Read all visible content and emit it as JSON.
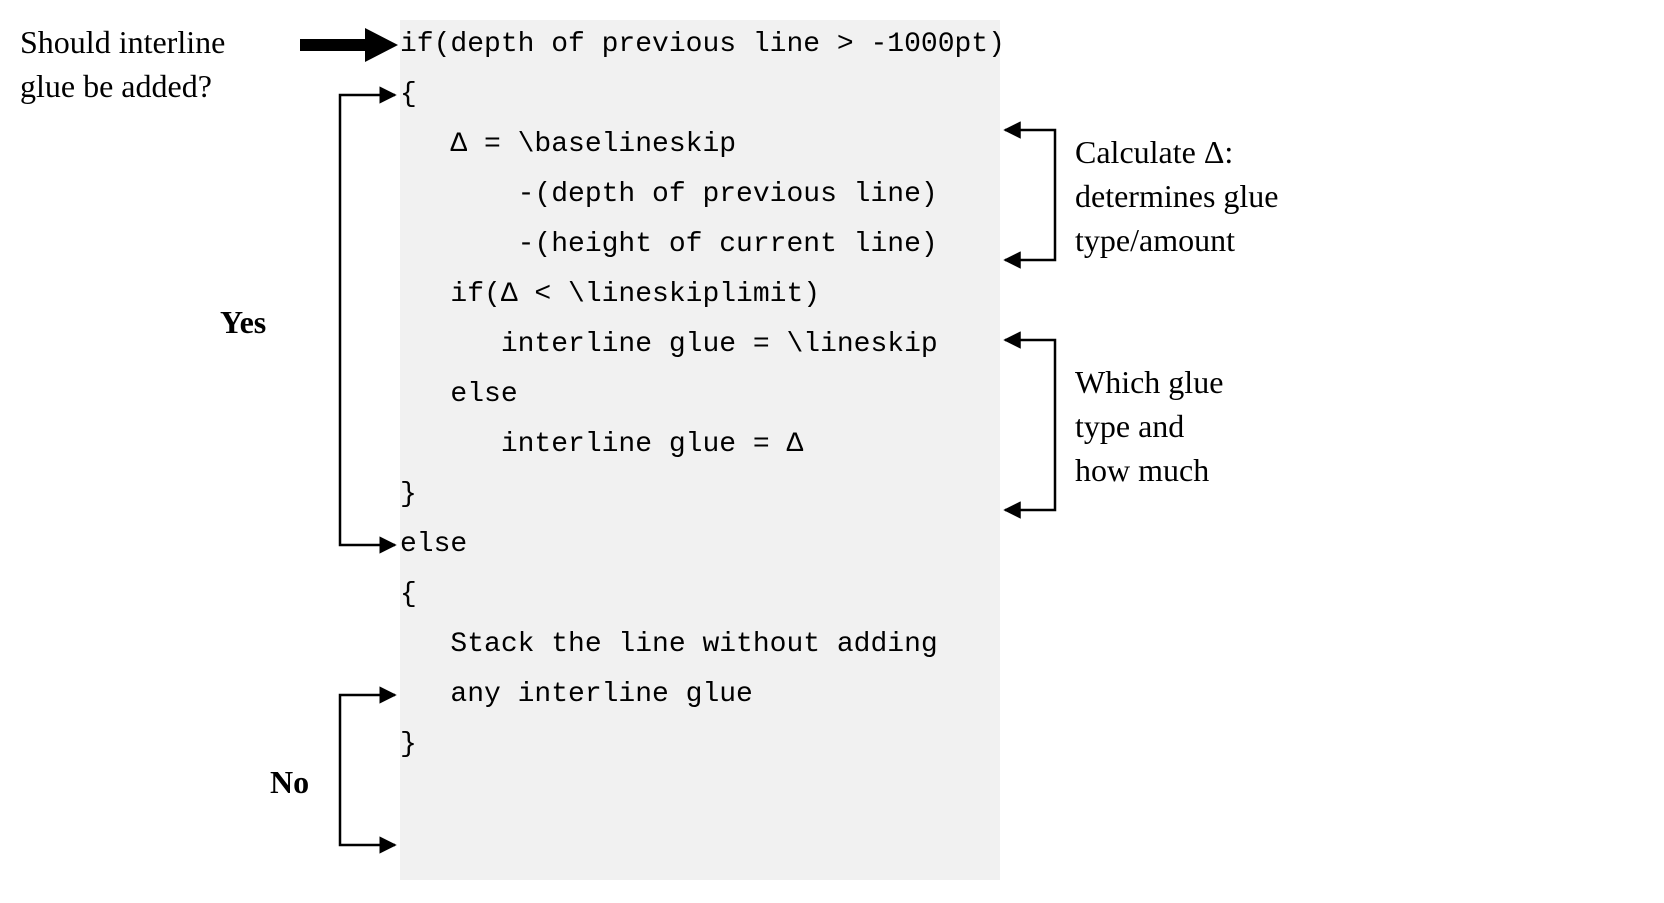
{
  "annotations": {
    "question": "Should interline\nglue be added?",
    "yes": "Yes",
    "no": "No",
    "calc": "Calculate Δ:\ndetermines glue\ntype/amount",
    "which": "Which glue\ntype and\nhow much"
  },
  "code": {
    "l1": "if(depth of previous line > -1000pt)",
    "l2": "{",
    "l3": "   Δ = \\baselineskip",
    "l4": "       -(depth of previous line)",
    "l5": "       -(height of current line)",
    "l6": "",
    "l7": "   if(Δ < \\lineskiplimit)",
    "l8": "      interline glue = \\lineskip",
    "l9": "   else",
    "l10": "      interline glue = Δ",
    "l11": "}",
    "l12": "",
    "l13": "else",
    "l14": "{",
    "l15": "   Stack the line without adding",
    "l16": "   any interline glue",
    "l17": "}"
  }
}
